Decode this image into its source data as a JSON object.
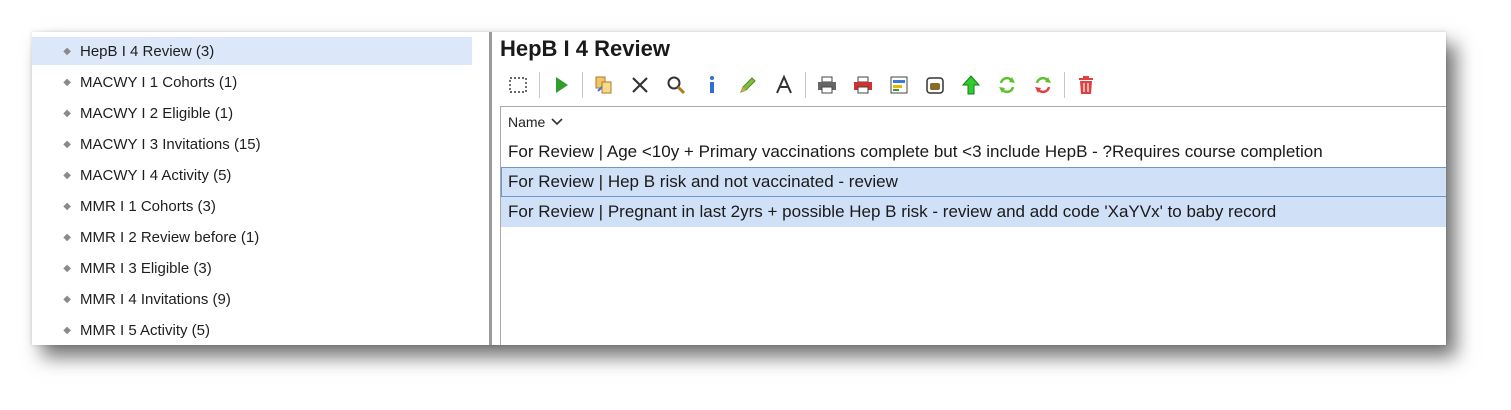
{
  "sidebar": {
    "items": [
      {
        "label": "HepB I 4 Review (3)",
        "selected": true
      },
      {
        "label": "MACWY I 1 Cohorts (1)",
        "selected": false
      },
      {
        "label": "MACWY I 2 Eligible (1)",
        "selected": false
      },
      {
        "label": "MACWY I 3 Invitations (15)",
        "selected": false
      },
      {
        "label": "MACWY I 4 Activity (5)",
        "selected": false
      },
      {
        "label": "MMR I 1 Cohorts (3)",
        "selected": false
      },
      {
        "label": "MMR I 2 Review before (1)",
        "selected": false
      },
      {
        "label": "MMR I 3 Eligible (3)",
        "selected": false
      },
      {
        "label": "MMR I 4 Invitations (9)",
        "selected": false
      },
      {
        "label": "MMR I 5 Activity (5)",
        "selected": false
      }
    ]
  },
  "main": {
    "title": "HepB I 4 Review",
    "toolbar": [
      {
        "icon": "select-marquee-icon"
      },
      {
        "separator": true
      },
      {
        "icon": "run-play-icon"
      },
      {
        "separator": true
      },
      {
        "icon": "copy-move-icon"
      },
      {
        "icon": "delete-x-icon"
      },
      {
        "icon": "search-magnifier-icon"
      },
      {
        "icon": "info-icon"
      },
      {
        "icon": "edit-pen-icon"
      },
      {
        "icon": "font-icon"
      },
      {
        "separator": true
      },
      {
        "icon": "print-icon"
      },
      {
        "icon": "print-red-icon"
      },
      {
        "icon": "report-icon"
      },
      {
        "icon": "archive-icon"
      },
      {
        "icon": "move-up-icon"
      },
      {
        "icon": "refresh-icon"
      },
      {
        "icon": "refresh-partial-icon"
      },
      {
        "separator": true
      },
      {
        "icon": "trash-icon"
      }
    ],
    "grid": {
      "column_header": "Name",
      "rows": [
        {
          "text": "For Review | Age <10y + Primary vaccinations complete but <3 include HepB - ?Requires course completion",
          "state": "normal"
        },
        {
          "text": "For Review | Hep B risk and not vaccinated - review",
          "state": "focused"
        },
        {
          "text": "For Review | Pregnant in last 2yrs + possible Hep B risk - review and add code 'XaYVx' to baby record",
          "state": "selected"
        }
      ]
    }
  },
  "colors": {
    "selection": "#cfe0f7",
    "focus_border": "#6f97cf",
    "tree_selection": "#dce8fa",
    "accent_green": "#2e9e2e",
    "accent_red": "#e04040"
  }
}
